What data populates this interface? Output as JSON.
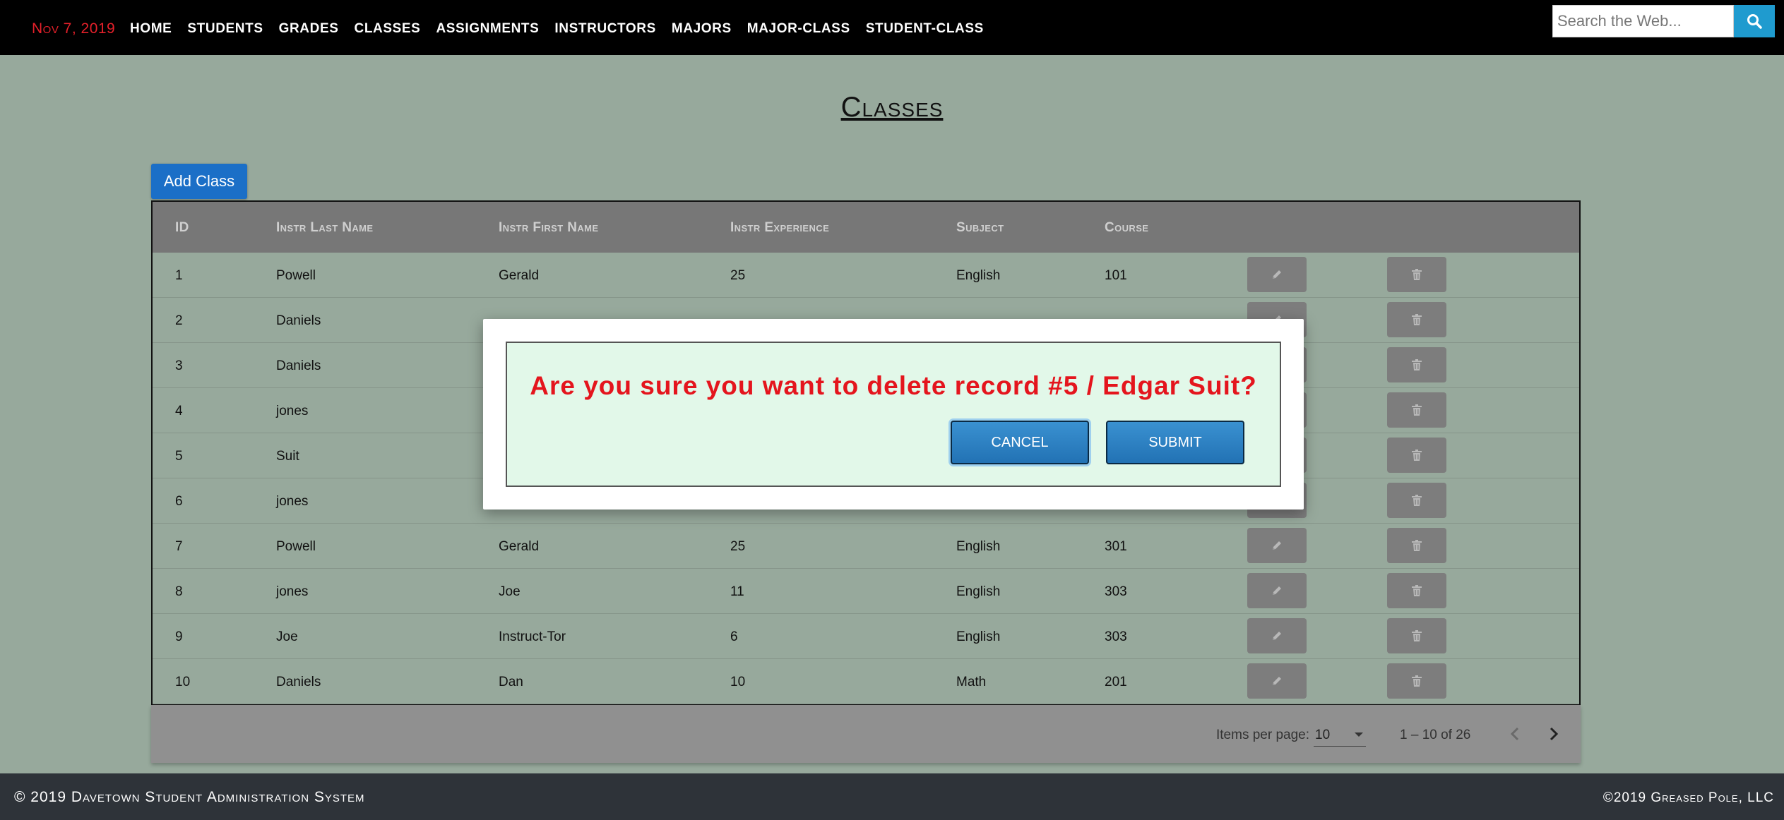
{
  "nav": {
    "date": "Nov 7, 2019",
    "links": [
      "HOME",
      "STUDENTS",
      "GRADES",
      "CLASSES",
      "ASSIGNMENTS",
      "INSTRUCTORS",
      "MAJORS",
      "MAJOR-CLASS",
      "STUDENT-CLASS"
    ],
    "search_placeholder": "Search the Web...",
    "search_icon": "search-icon"
  },
  "page": {
    "title": "Classes",
    "add_button": "Add Class"
  },
  "table": {
    "headers": [
      "ID",
      "Instr Last Name",
      "Instr First Name",
      "Instr Experience",
      "Subject",
      "Course"
    ],
    "rows": [
      [
        "1",
        "Powell",
        "Gerald",
        "25",
        "English",
        "101"
      ],
      [
        "2",
        "Daniels",
        "",
        "",
        "",
        ""
      ],
      [
        "3",
        "Daniels",
        "",
        "",
        "",
        ""
      ],
      [
        "4",
        "jones",
        "",
        "",
        "",
        ""
      ],
      [
        "5",
        "Suit",
        "",
        "",
        "",
        ""
      ],
      [
        "6",
        "jones",
        "",
        "",
        "",
        ""
      ],
      [
        "7",
        "Powell",
        "Gerald",
        "25",
        "English",
        "301"
      ],
      [
        "8",
        "jones",
        "Joe",
        "11",
        "English",
        "303"
      ],
      [
        "9",
        "Joe",
        "Instruct-Tor",
        "6",
        "English",
        "303"
      ],
      [
        "10",
        "Daniels",
        "Dan",
        "10",
        "Math",
        "201"
      ]
    ],
    "edit_icon": "pencil-icon",
    "delete_icon": "trash-icon"
  },
  "paginator": {
    "items_per_page_label": "Items per page:",
    "items_per_page_value": "10",
    "range": "1 – 10 of 26"
  },
  "footer": {
    "left": "© 2019 Davetown Student Administration System",
    "right": "©2019 Greased Pole, LLC"
  },
  "modal": {
    "message": "Are you sure you want to delete record #5 / Edgar Suit?",
    "cancel": "CANCEL",
    "submit": "SUBMIT"
  },
  "colors": {
    "background": "#97a99c",
    "nav": "#000000",
    "accent_red": "#e4151d",
    "button_blue": "#1b6fc7",
    "modal_bg": "#e2f8e9"
  }
}
